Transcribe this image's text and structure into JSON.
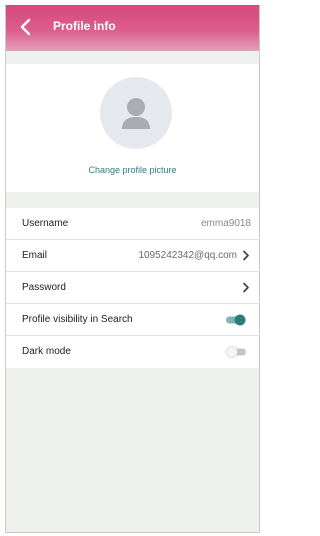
{
  "header": {
    "title": "Profile info"
  },
  "profile": {
    "change_picture_label": "Change profile picture"
  },
  "settings": [
    {
      "label": "Username",
      "value": "emma9018"
    },
    {
      "label": "Email",
      "value": "1095242342@qq.com"
    },
    {
      "label": "Password"
    },
    {
      "label": "Profile visibility in Search",
      "toggle": "on"
    },
    {
      "label": "Dark mode",
      "toggle": "off"
    }
  ],
  "colors": {
    "header_gradient_top": "#d9487c",
    "header_gradient_bottom": "#e3a1b8",
    "accent_teal": "#2e7d77",
    "link_teal": "#2d7f85"
  },
  "icons": {
    "back": "chevron-left-icon",
    "avatar": "user-silhouette-icon",
    "row_chevron": "chevron-right-icon"
  }
}
